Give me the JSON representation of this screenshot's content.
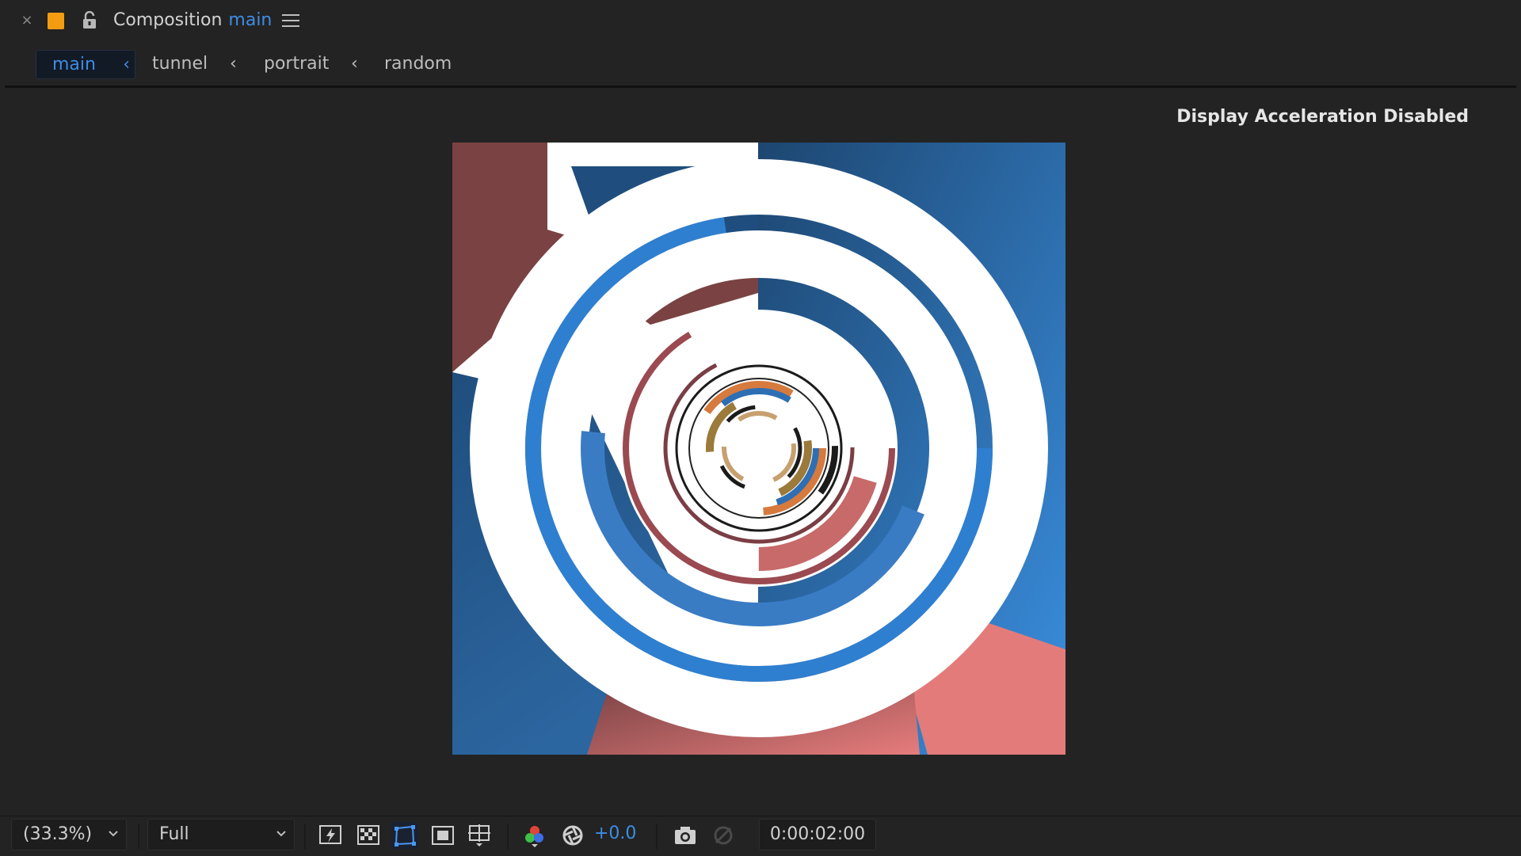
{
  "titlebar": {
    "close_glyph": "×",
    "swatch_color": "#f39c12",
    "lock_icon": "lock-open-icon",
    "label": "Composition",
    "comp_name": "main",
    "accent_color": "#3d8de6",
    "menu_icon": "hamburger-menu-icon"
  },
  "breadcrumbs": [
    {
      "label": "main",
      "active": true
    },
    {
      "label": "tunnel",
      "active": false
    },
    {
      "label": "portrait",
      "active": false
    },
    {
      "label": "random",
      "active": false
    }
  ],
  "breadcrumb_separator": "‹",
  "viewer": {
    "notice": "Display Acceleration Disabled"
  },
  "toolbar": {
    "magnification": "(33.3%)",
    "resolution": "Full",
    "exposure": "+0.0",
    "timecode": "0:00:02:00",
    "icons": [
      "fast-previews-icon",
      "transparency-grid-icon",
      "mask-path-visibility-icon",
      "region-of-interest-icon",
      "grid-guides-icon",
      "color-channels-icon",
      "reset-exposure-icon",
      "snapshot-camera-icon",
      "show-snapshot-icon"
    ]
  },
  "colors": {
    "panel": "#232323",
    "accent_blue": "#3d8de6",
    "maroon": "#7a4040",
    "dark_blue": "#1f4e7e",
    "salmon": "#e07a7a"
  }
}
